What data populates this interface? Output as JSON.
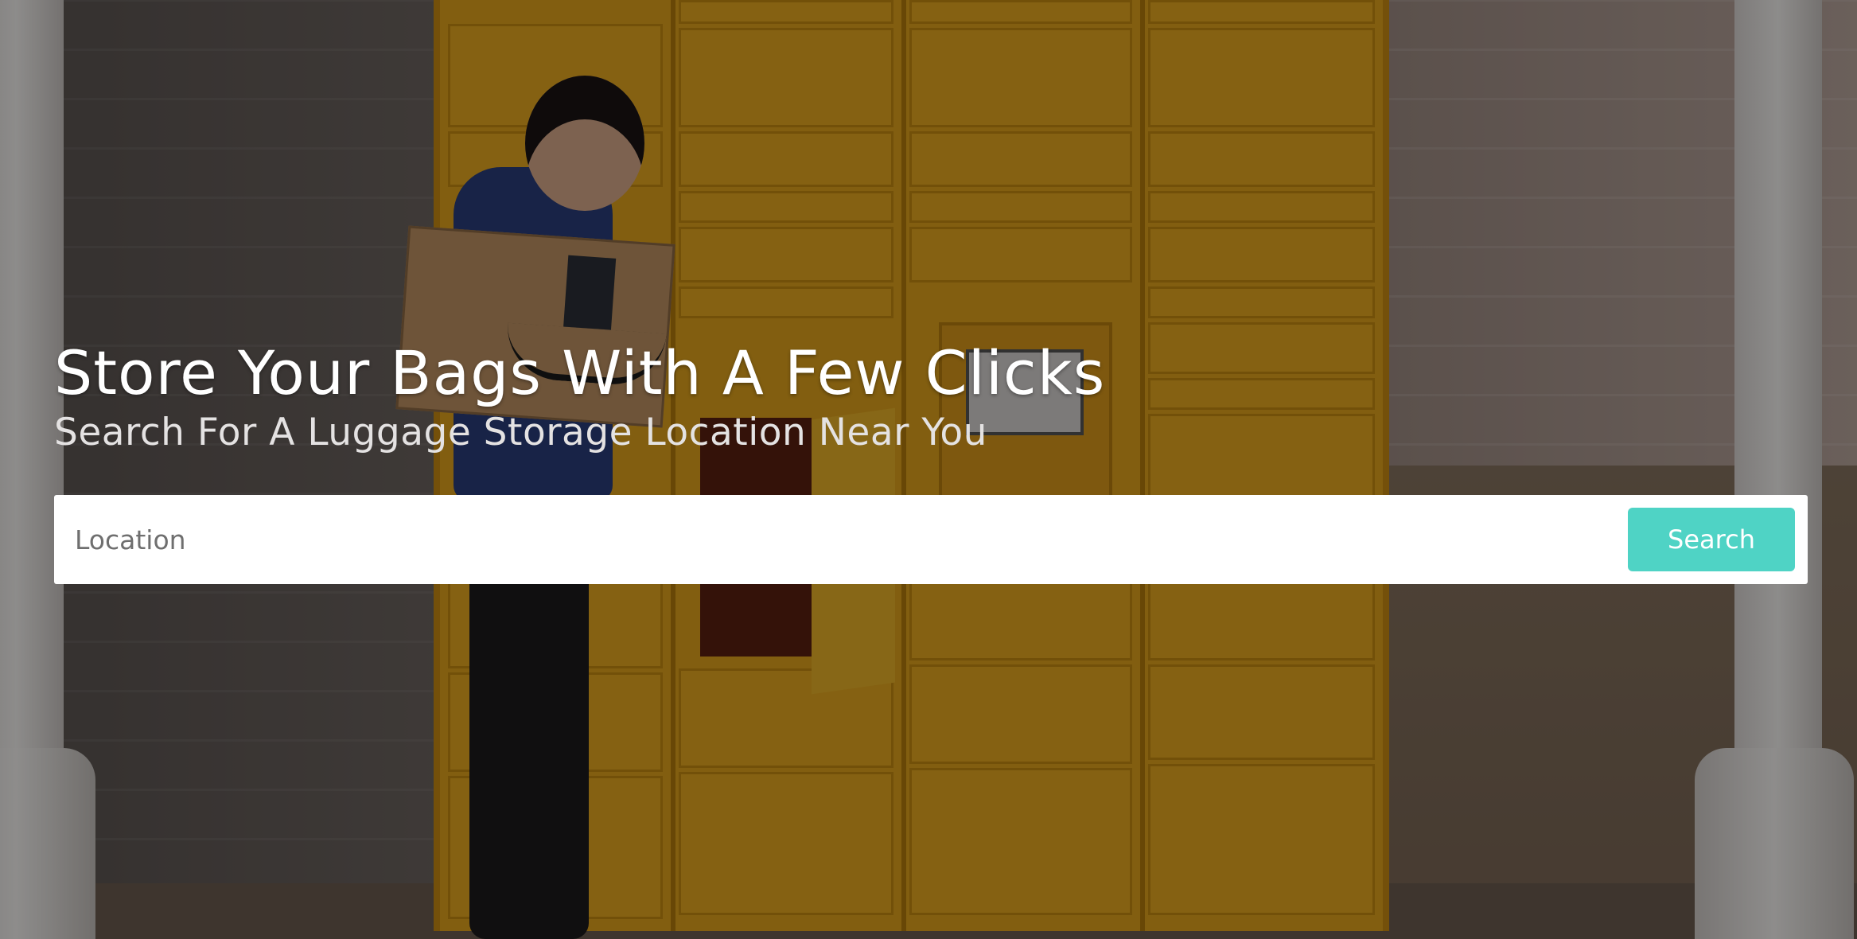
{
  "hero": {
    "headline": "Store Your Bags With A Few Clicks",
    "subheadline": "Search For A Luggage Storage Location Near You",
    "background": "locker-photo"
  },
  "search": {
    "placeholder": "Location",
    "value": "",
    "button_label": "Search",
    "button_color": "#4fd3c5"
  }
}
